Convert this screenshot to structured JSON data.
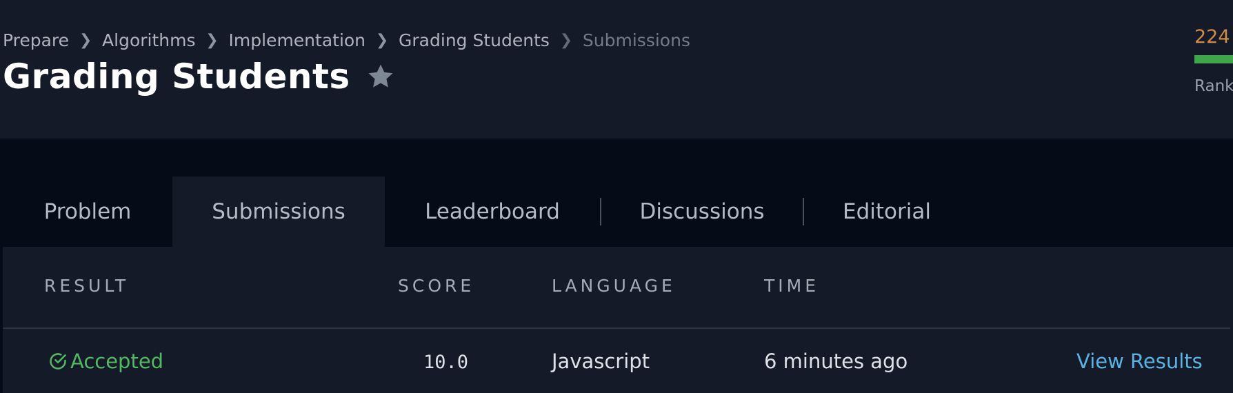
{
  "breadcrumb": {
    "items": [
      "Prepare",
      "Algorithms",
      "Implementation",
      "Grading Students",
      "Submissions"
    ]
  },
  "page": {
    "title": "Grading Students"
  },
  "rank": {
    "value": "224",
    "label": "Rank"
  },
  "tabs": [
    {
      "label": "Problem",
      "active": false
    },
    {
      "label": "Submissions",
      "active": true
    },
    {
      "label": "Leaderboard",
      "active": false
    },
    {
      "label": "Discussions",
      "active": false
    },
    {
      "label": "Editorial",
      "active": false
    }
  ],
  "table": {
    "headers": {
      "result": "RESULT",
      "score": "SCORE",
      "language": "LANGUAGE",
      "time": "TIME"
    },
    "rows": [
      {
        "result": "Accepted",
        "score": "10.0",
        "language": "Javascript",
        "time": "6 minutes ago",
        "action": "View Results"
      }
    ]
  },
  "colors": {
    "accepted": "#52b862",
    "link": "#5ab3e3",
    "rank_value": "#d08b46",
    "rank_bar": "#3fa64b"
  },
  "icons": {
    "star": "star-icon",
    "check": "check-circle-icon",
    "separator": "chevron-right-icon"
  }
}
